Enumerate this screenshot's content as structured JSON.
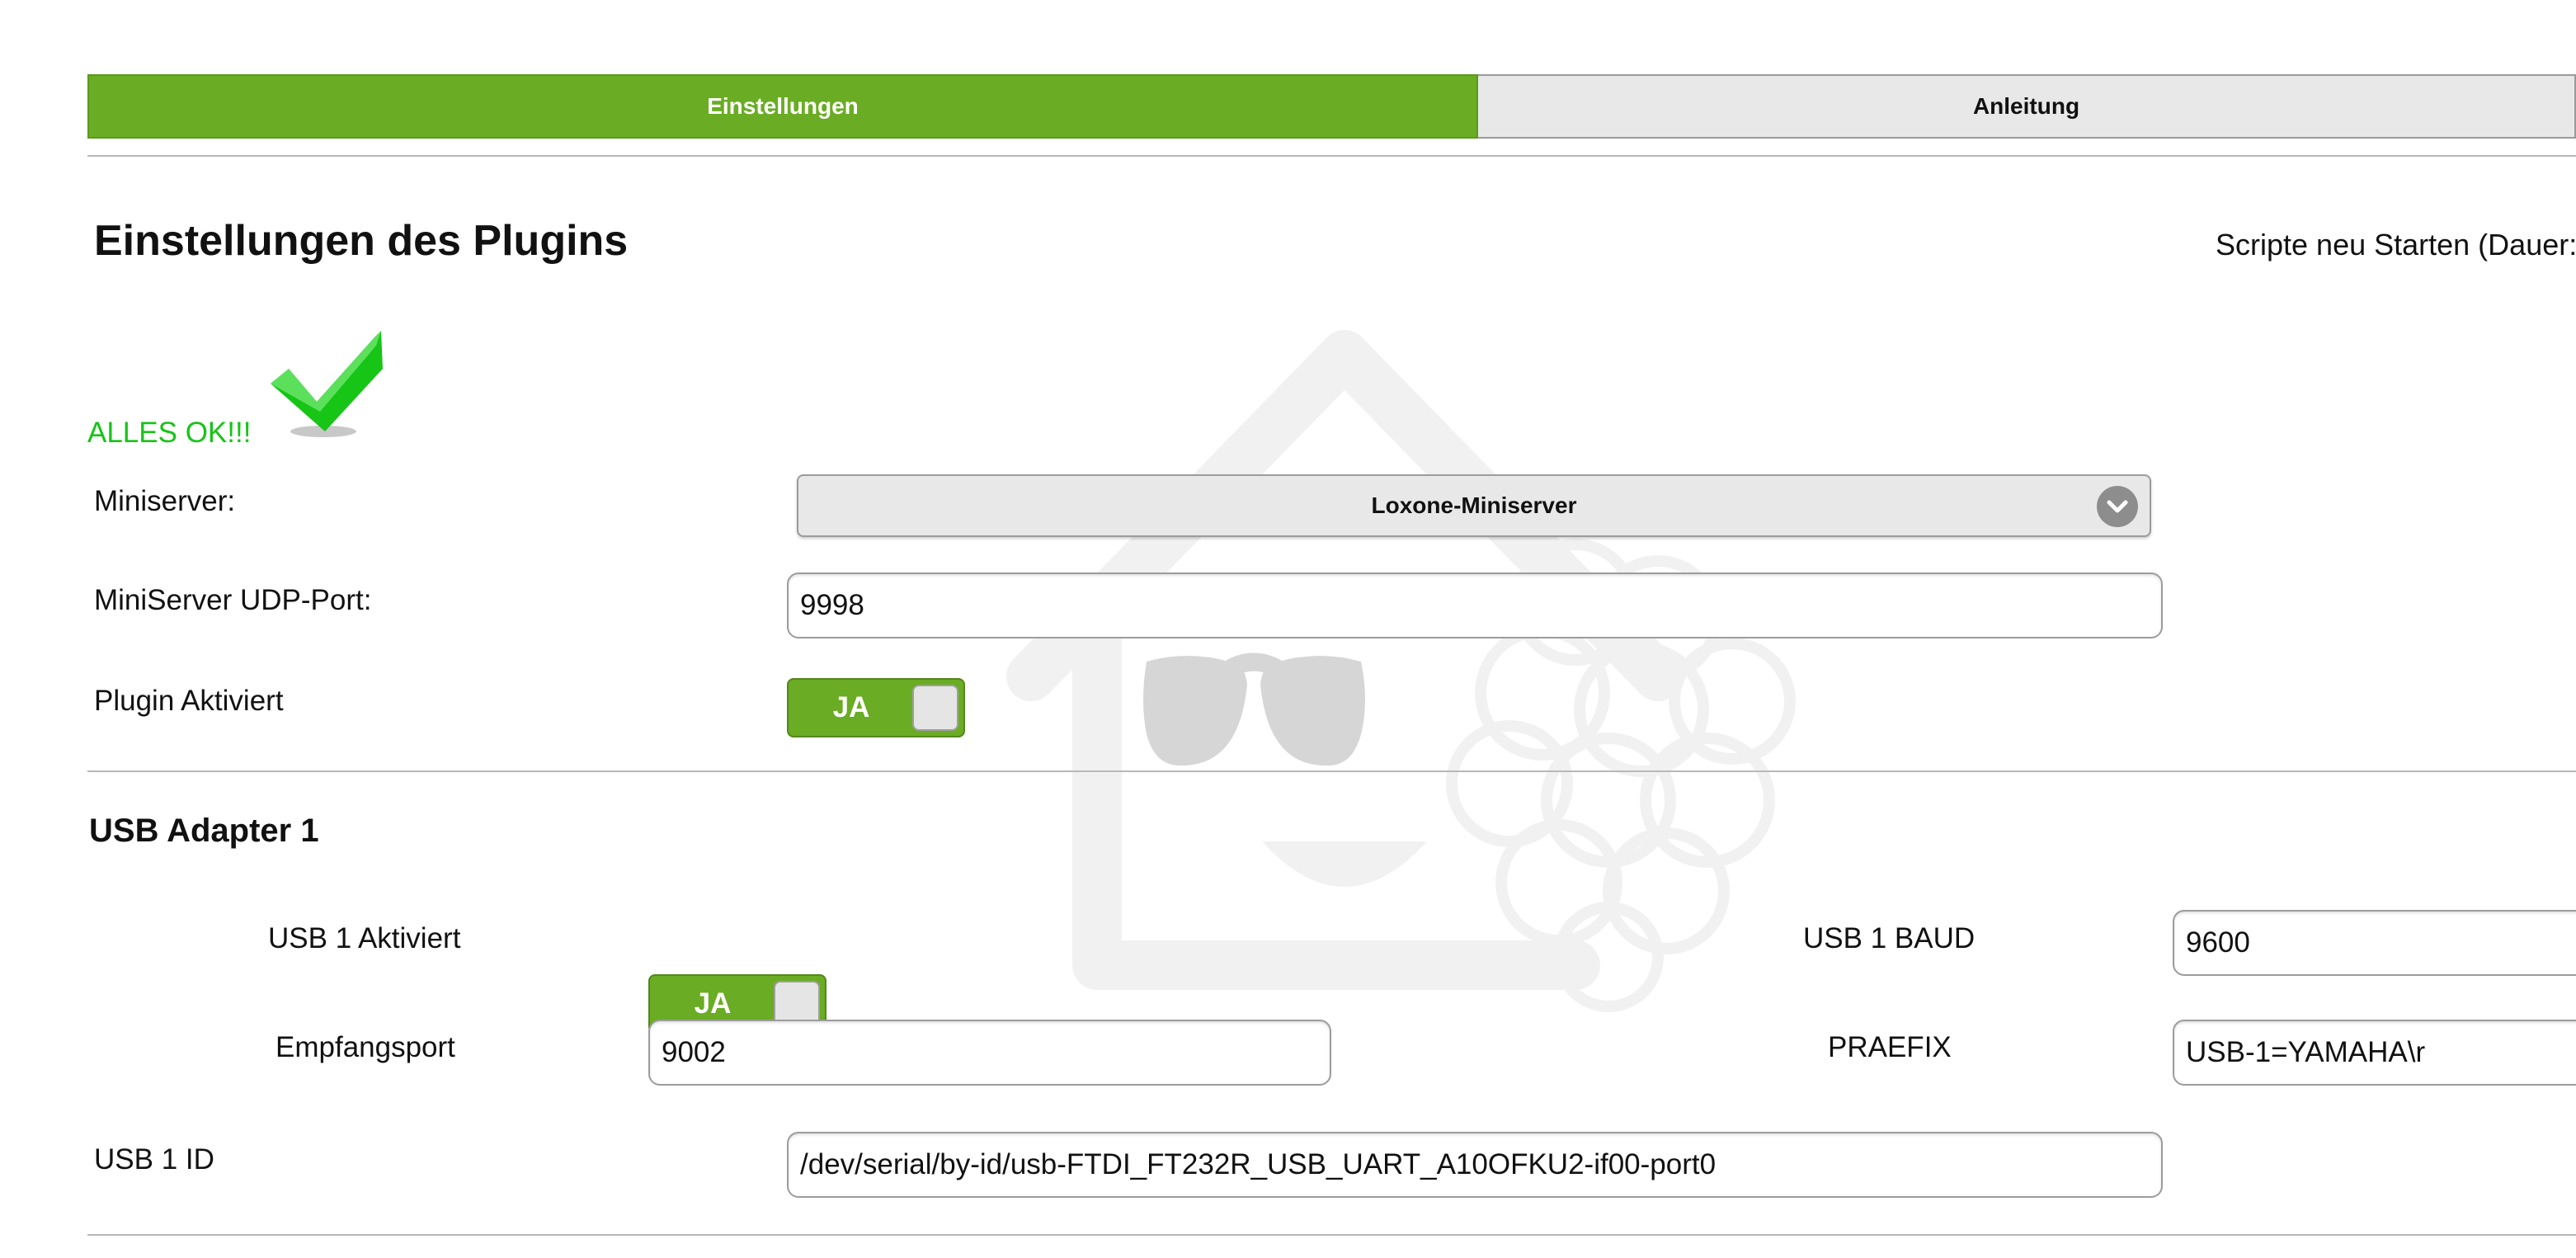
{
  "tabs": [
    {
      "label": "Einstellungen",
      "active": true
    },
    {
      "label": "Anleitung",
      "active": false
    }
  ],
  "page": {
    "title": "Einstellungen des Plugins",
    "restart_label": "Scripte neu Starten (Dauer:",
    "status_text": "ALLES OK!!!",
    "status_icon": "checkmark-icon"
  },
  "settings": {
    "miniserver_label": "Miniserver:",
    "miniserver_value": "Loxone-Miniserver",
    "udp_port_label": "MiniServer UDP-Port:",
    "udp_port_value": "9998",
    "plugin_active_label": "Plugin Aktiviert",
    "plugin_active_value": "JA"
  },
  "usb1": {
    "section_title": "USB Adapter 1",
    "active_label": "USB 1 Aktiviert",
    "active_value": "JA",
    "baud_label": "USB 1 BAUD",
    "baud_value": "9600",
    "receive_port_label": "Empfangsport",
    "receive_port_value": "9002",
    "prefix_label": "PRAEFIX",
    "prefix_value": "USB-1=YAMAHA\\r",
    "id_label": "USB 1 ID",
    "id_value": "/dev/serial/by-id/usb-FTDI_FT232R_USB_UART_A10OFKU2-if00-port0"
  },
  "colors": {
    "accent": "#6aac23",
    "status_ok": "#17c417",
    "tab_inactive": "#e8e8e8"
  }
}
